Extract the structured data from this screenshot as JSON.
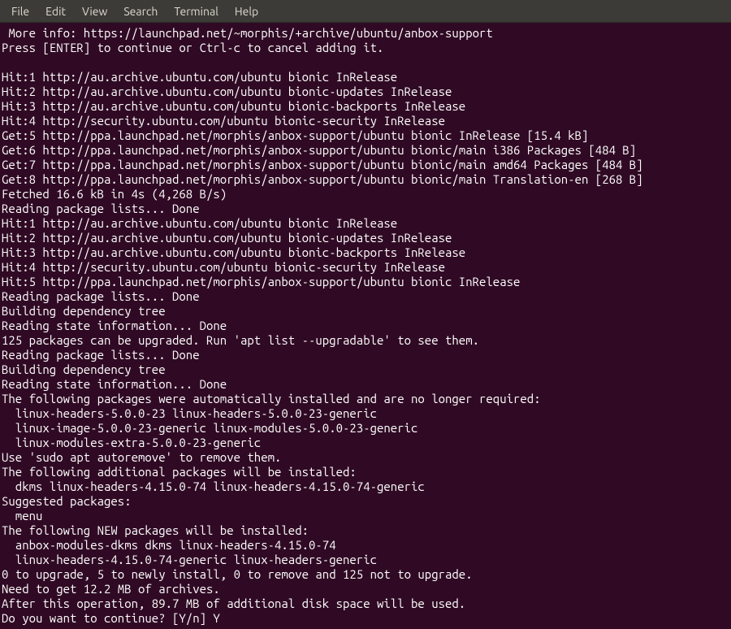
{
  "menubar": {
    "items": [
      "File",
      "Edit",
      "View",
      "Search",
      "Terminal",
      "Help"
    ]
  },
  "terminal": {
    "lines": [
      " More info: https://launchpad.net/~morphis/+archive/ubuntu/anbox-support",
      "Press [ENTER] to continue or Ctrl-c to cancel adding it.",
      "",
      "Hit:1 http://au.archive.ubuntu.com/ubuntu bionic InRelease",
      "Hit:2 http://au.archive.ubuntu.com/ubuntu bionic-updates InRelease",
      "Hit:3 http://au.archive.ubuntu.com/ubuntu bionic-backports InRelease",
      "Hit:4 http://security.ubuntu.com/ubuntu bionic-security InRelease",
      "Get:5 http://ppa.launchpad.net/morphis/anbox-support/ubuntu bionic InRelease [15.4 kB]",
      "Get:6 http://ppa.launchpad.net/morphis/anbox-support/ubuntu bionic/main i386 Packages [484 B]",
      "Get:7 http://ppa.launchpad.net/morphis/anbox-support/ubuntu bionic/main amd64 Packages [484 B]",
      "Get:8 http://ppa.launchpad.net/morphis/anbox-support/ubuntu bionic/main Translation-en [268 B]",
      "Fetched 16.6 kB in 4s (4,268 B/s)",
      "Reading package lists... Done",
      "Hit:1 http://au.archive.ubuntu.com/ubuntu bionic InRelease",
      "Hit:2 http://au.archive.ubuntu.com/ubuntu bionic-updates InRelease",
      "Hit:3 http://au.archive.ubuntu.com/ubuntu bionic-backports InRelease",
      "Hit:4 http://security.ubuntu.com/ubuntu bionic-security InRelease",
      "Hit:5 http://ppa.launchpad.net/morphis/anbox-support/ubuntu bionic InRelease",
      "Reading package lists... Done",
      "Building dependency tree",
      "Reading state information... Done",
      "125 packages can be upgraded. Run 'apt list --upgradable' to see them.",
      "Reading package lists... Done",
      "Building dependency tree",
      "Reading state information... Done",
      "The following packages were automatically installed and are no longer required:",
      "  linux-headers-5.0.0-23 linux-headers-5.0.0-23-generic",
      "  linux-image-5.0.0-23-generic linux-modules-5.0.0-23-generic",
      "  linux-modules-extra-5.0.0-23-generic",
      "Use 'sudo apt autoremove' to remove them.",
      "The following additional packages will be installed:",
      "  dkms linux-headers-4.15.0-74 linux-headers-4.15.0-74-generic",
      "Suggested packages:",
      "  menu",
      "The following NEW packages will be installed:",
      "  anbox-modules-dkms dkms linux-headers-4.15.0-74",
      "  linux-headers-4.15.0-74-generic linux-headers-generic",
      "0 to upgrade, 5 to newly install, 0 to remove and 125 not to upgrade.",
      "Need to get 12.2 MB of archives.",
      "After this operation, 89.7 MB of additional disk space will be used.",
      "Do you want to continue? [Y/n] Y"
    ]
  }
}
